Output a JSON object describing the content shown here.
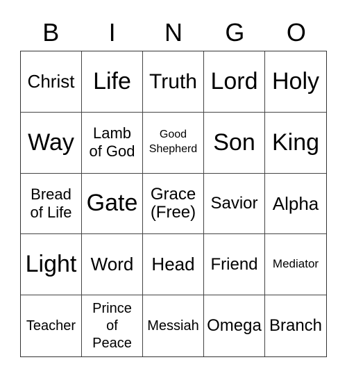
{
  "header": [
    "B",
    "I",
    "N",
    "G",
    "O"
  ],
  "cells": [
    {
      "text": "Christ",
      "size": "s27"
    },
    {
      "text": "Life",
      "size": "s36"
    },
    {
      "text": "Truth",
      "size": "s30"
    },
    {
      "text": "Lord",
      "size": "s36"
    },
    {
      "text": "Holy",
      "size": "s36"
    },
    {
      "text": "Way",
      "size": "s36"
    },
    {
      "text": "Lamb\nof God",
      "size": "s22"
    },
    {
      "text": "Good\nShepherd",
      "size": "s16"
    },
    {
      "text": "Son",
      "size": "s36"
    },
    {
      "text": "King",
      "size": "s36"
    },
    {
      "text": "Bread\nof Life",
      "size": "s22"
    },
    {
      "text": "Gate",
      "size": "s36"
    },
    {
      "text": "Grace\n(Free)",
      "size": "s24"
    },
    {
      "text": "Savior",
      "size": "s24"
    },
    {
      "text": "Alpha",
      "size": "s27"
    },
    {
      "text": "Light",
      "size": "s36"
    },
    {
      "text": "Word",
      "size": "s27"
    },
    {
      "text": "Head",
      "size": "s27"
    },
    {
      "text": "Friend",
      "size": "s24"
    },
    {
      "text": "Mediator",
      "size": "s17"
    },
    {
      "text": "Teacher",
      "size": "s20"
    },
    {
      "text": "Prince\nof\nPeace",
      "size": "s20"
    },
    {
      "text": "Messiah",
      "size": "s20"
    },
    {
      "text": "Omega",
      "size": "s24"
    },
    {
      "text": "Branch",
      "size": "s24"
    }
  ]
}
